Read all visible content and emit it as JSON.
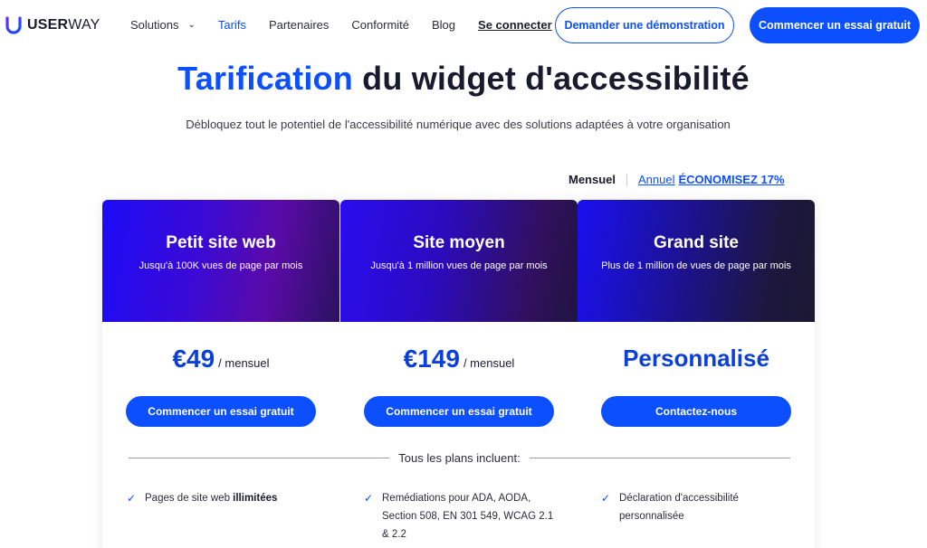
{
  "nav": {
    "logo_strong": "USER",
    "logo_light": "WAY",
    "links": [
      {
        "label": "Solutions",
        "has_chevron": true
      },
      {
        "label": "Tarifs",
        "active": true
      },
      {
        "label": "Partenaires"
      },
      {
        "label": "Conformité"
      },
      {
        "label": "Blog"
      }
    ],
    "login": "Se connecter",
    "demo_button": "Demander une démonstration",
    "trial_button": "Commencer un essai gratuit"
  },
  "hero": {
    "title_accent": "Tarification",
    "title_rest": " du widget d'accessibilité",
    "subtitle": "Débloquez tout le potentiel de l'accessibilité numérique avec des solutions adaptées à votre organisation"
  },
  "billing": {
    "monthly": "Mensuel",
    "annual": "Annuel",
    "save": "ÉCONOMISEZ 17%"
  },
  "plans": [
    {
      "name": "Petit site web",
      "desc": "Jusqu'à 100K vues de page par mois",
      "price": "€49",
      "period": "/ mensuel",
      "button": "Commencer un essai gratuit"
    },
    {
      "name": "Site moyen",
      "desc": "Jusqu'à 1 million vues de page par mois",
      "price": "€149",
      "period": "/ mensuel",
      "button": "Commencer un essai gratuit"
    },
    {
      "name": "Grand site",
      "desc": "Plus de 1 million de vues de page par mois",
      "price": "Personnalisé",
      "button": "Contactez-nous"
    }
  ],
  "includes": {
    "heading": "Tous les plans incluent:",
    "features": [
      {
        "text": "Pages de site web ",
        "bold": "illimitées"
      },
      {
        "text": "Remédiations pour ADA, AODA, Section 508, EN 301 549, WCAG 2.1 & 2.2"
      },
      {
        "text": "Déclaration d'accessibilité personnalisée"
      }
    ]
  },
  "colors": {
    "accent": "#0b4fff",
    "text": "#1a1a2e"
  },
  "icons": [
    "userway-logo-icon",
    "chevron-down-icon",
    "check-icon"
  ]
}
